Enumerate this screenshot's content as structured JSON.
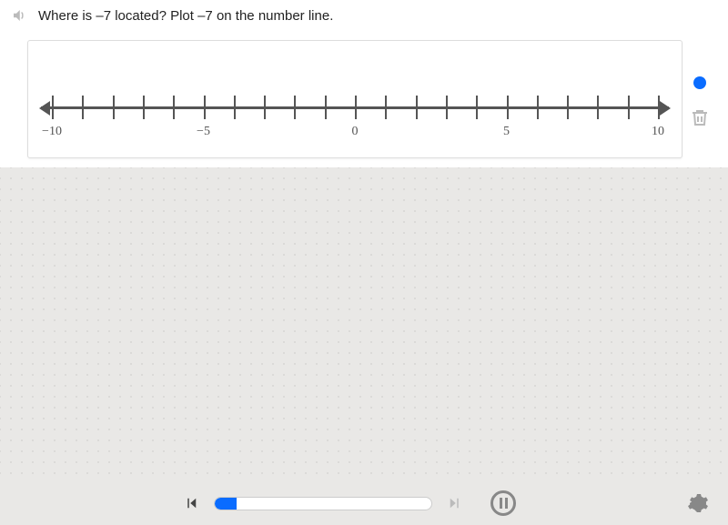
{
  "question": {
    "text": "Where is –7 located? Plot –7 on the number line."
  },
  "numberline": {
    "min": -10,
    "max": 10,
    "tick_step": 1,
    "labeled_ticks": [
      {
        "value": -10,
        "label": "−10"
      },
      {
        "value": -5,
        "label": "−5"
      },
      {
        "value": 0,
        "label": "0"
      },
      {
        "value": 5,
        "label": "5"
      },
      {
        "value": 10,
        "label": "10"
      }
    ]
  },
  "tools": {
    "point": "point-tool",
    "trash": "delete-tool"
  },
  "player": {
    "previous": "prev",
    "next": "next",
    "pause": "pause",
    "settings": "settings",
    "progress_percent": 10
  },
  "colors": {
    "accent": "#0a6cff",
    "axis": "#555555",
    "panel": "#e9e8e6"
  }
}
